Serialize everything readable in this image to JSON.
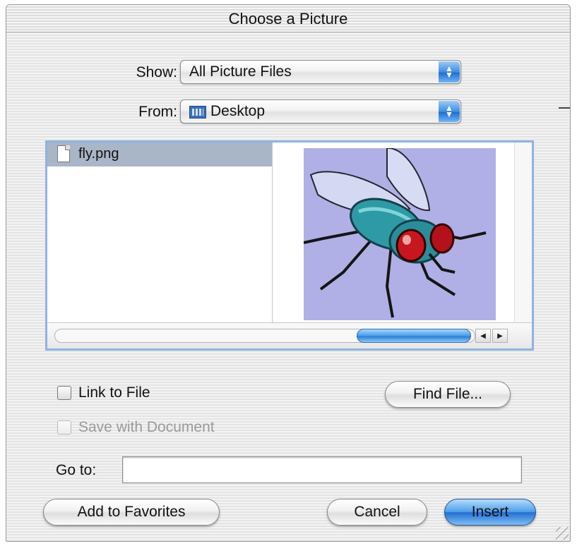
{
  "window": {
    "title": "Choose a Picture"
  },
  "show": {
    "label": "Show:",
    "value": "All Picture Files"
  },
  "from": {
    "label": "From:",
    "value": "Desktop",
    "icon": "desktop-folder-icon"
  },
  "browser": {
    "files": [
      {
        "name": "fly.png",
        "icon": "document-icon",
        "selected": true
      }
    ],
    "preview": {
      "subject": "fly-illustration",
      "background": "#b0b0e6"
    }
  },
  "options": {
    "link_to_file": {
      "label": "Link to File",
      "checked": false,
      "enabled": true
    },
    "save_with_document": {
      "label": "Save with Document",
      "checked": false,
      "enabled": false
    }
  },
  "goto": {
    "label": "Go to:",
    "value": ""
  },
  "buttons": {
    "find_file": "Find File...",
    "add_to_favorites": "Add to Favorites",
    "cancel": "Cancel",
    "insert": "Insert"
  },
  "colors": {
    "accent": "#3d8ee3",
    "selection": "#a9b6c8",
    "browser_border": "#8fb4de"
  }
}
